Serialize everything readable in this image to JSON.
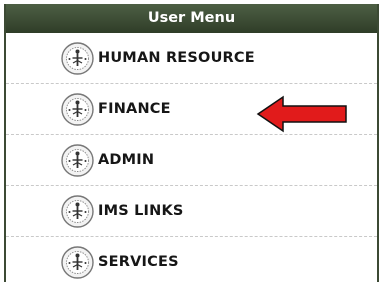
{
  "menu": {
    "title": "User Menu",
    "items": [
      {
        "label": "HUMAN RESOURCE",
        "icon": "emblem-icon"
      },
      {
        "label": "FINANCE",
        "icon": "emblem-icon"
      },
      {
        "label": "ADMIN",
        "icon": "emblem-icon"
      },
      {
        "label": "IMS LINKS",
        "icon": "emblem-icon"
      },
      {
        "label": "SERVICES",
        "icon": "emblem-icon"
      }
    ]
  },
  "annotation": {
    "target": "FINANCE",
    "color": "#e11b1b",
    "icon": "red-arrow-icon"
  },
  "colors": {
    "header": "#3c4a34",
    "text": "#161616",
    "divider": "#c9c9c9"
  }
}
